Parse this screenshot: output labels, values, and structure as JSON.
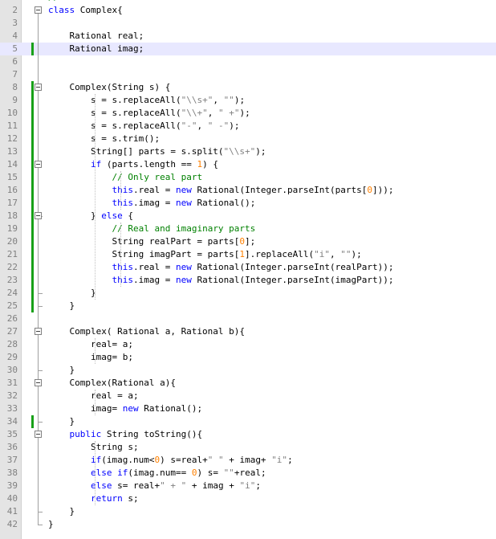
{
  "editor": {
    "top_partial_line": "// Class Code",
    "lines": [
      {
        "n": "2",
        "text": "class Complex{"
      },
      {
        "n": "3",
        "text": ""
      },
      {
        "n": "4",
        "text": "    Rational real;"
      },
      {
        "n": "5",
        "text": "    Rational imag;"
      },
      {
        "n": "6",
        "text": ""
      },
      {
        "n": "7",
        "text": ""
      },
      {
        "n": "8",
        "text": "    Complex(String s) {"
      },
      {
        "n": "9",
        "text": "        s = s.replaceAll(\"\\\\s+\", \"\");"
      },
      {
        "n": "10",
        "text": "        s = s.replaceAll(\"\\\\+\", \" +\");"
      },
      {
        "n": "11",
        "text": "        s = s.replaceAll(\"-\", \" -\");"
      },
      {
        "n": "12",
        "text": "        s = s.trim();"
      },
      {
        "n": "13",
        "text": "        String[] parts = s.split(\"\\\\s+\");"
      },
      {
        "n": "14",
        "text": "        if (parts.length == 1) {"
      },
      {
        "n": "15",
        "text": "            // Only real part"
      },
      {
        "n": "16",
        "text": "            this.real = new Rational(Integer.parseInt(parts[0]));"
      },
      {
        "n": "17",
        "text": "            this.imag = new Rational();"
      },
      {
        "n": "18",
        "text": "        } else {"
      },
      {
        "n": "19",
        "text": "            // Real and imaginary parts"
      },
      {
        "n": "20",
        "text": "            String realPart = parts[0];"
      },
      {
        "n": "21",
        "text": "            String imagPart = parts[1].replaceAll(\"i\", \"\");"
      },
      {
        "n": "22",
        "text": "            this.real = new Rational(Integer.parseInt(realPart));"
      },
      {
        "n": "23",
        "text": "            this.imag = new Rational(Integer.parseInt(imagPart));"
      },
      {
        "n": "24",
        "text": "        }"
      },
      {
        "n": "25",
        "text": "    }"
      },
      {
        "n": "26",
        "text": ""
      },
      {
        "n": "27",
        "text": "    Complex( Rational a, Rational b){"
      },
      {
        "n": "28",
        "text": "        real= a;"
      },
      {
        "n": "29",
        "text": "        imag= b;"
      },
      {
        "n": "30",
        "text": "    }"
      },
      {
        "n": "31",
        "text": "    Complex(Rational a){"
      },
      {
        "n": "32",
        "text": "        real = a;"
      },
      {
        "n": "33",
        "text": "        imag= new Rational();"
      },
      {
        "n": "34",
        "text": "    }"
      },
      {
        "n": "35",
        "text": "    public String toString(){"
      },
      {
        "n": "36",
        "text": "        String s;"
      },
      {
        "n": "37",
        "text": "        if(imag.num<0) s=real+\" \" + imag+ \"i\";"
      },
      {
        "n": "38",
        "text": "        else if(imag.num== 0) s= \"\"+real;"
      },
      {
        "n": "39",
        "text": "        else s= real+\" + \" + imag + \"i\";"
      },
      {
        "n": "40",
        "text": "        return s;"
      },
      {
        "n": "41",
        "text": "    }"
      },
      {
        "n": "42",
        "text": "}"
      }
    ],
    "colors": {
      "keyword": "#0000ff",
      "number": "#ff8000",
      "string": "#808080",
      "comment": "#008000",
      "gutter": "#e4e4e4",
      "current_line": "#e8e8ff",
      "change_marker": "#18a018"
    }
  }
}
